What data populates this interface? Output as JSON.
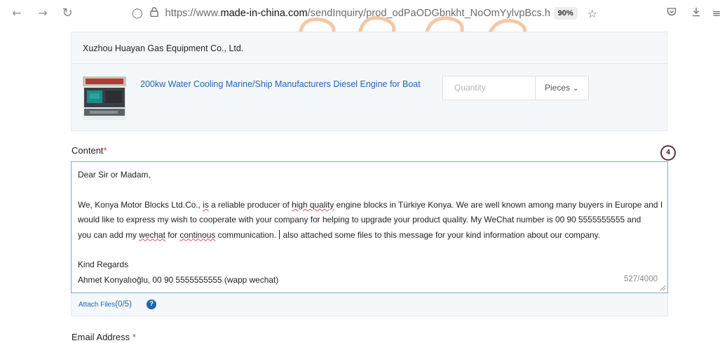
{
  "browser": {
    "back_icon": "arrow-left",
    "forward_icon": "arrow-right",
    "reload_icon": "reload",
    "url_prefix": "https://www.",
    "url_domain": "made-in-china.com",
    "url_path": "/sendInquiry/prod_odPaODGbnkht_NoOmYylvpBcs.ht",
    "zoom": "90%"
  },
  "inquiry": {
    "supplier": "Xuzhou Huayan Gas Equipment Co., Ltd.",
    "product_title": "200kw Water Cooling Marine/Ship Manufacturers Diesel Engine for Boat",
    "quantity_placeholder": "Quantity",
    "unit": "Pieces",
    "content_label": "Content",
    "required_mark": "*",
    "step_marker": "4",
    "message": {
      "greeting": "Dear Sir or Madam,",
      "l1_a": "We, Konya Motor Blocks Ltd.Co., ",
      "l1_b": "is",
      "l1_c": " a reliable producer of ",
      "l1_d": "high quality",
      "l1_e": " engine blocks in Türkiye Konya. We are well known among many buyers in Europe and I",
      "l2": "would like to express my wish to cooperate with your company for helping to upgrade your product quality. My WeChat number is 00 90 5555555555  and",
      "l3_a": "you can add my ",
      "l3_b": "wechat",
      "l3_c": " for ",
      "l3_d": "continous",
      "l3_e": " communication. ",
      "l3_f": " also attached some files to this message for your kind information about our company.",
      "regards": "Kind Regards",
      "signature": "Ahmet Konyalıoğlu, 00 90 5555555555 (wapp wechat)"
    },
    "char_count": "527/4000",
    "attach_label": "Attach Files",
    "attach_count": "(0/5)",
    "help_icon": "?",
    "email_label": "Email Address",
    "email_required_mark": "*"
  }
}
